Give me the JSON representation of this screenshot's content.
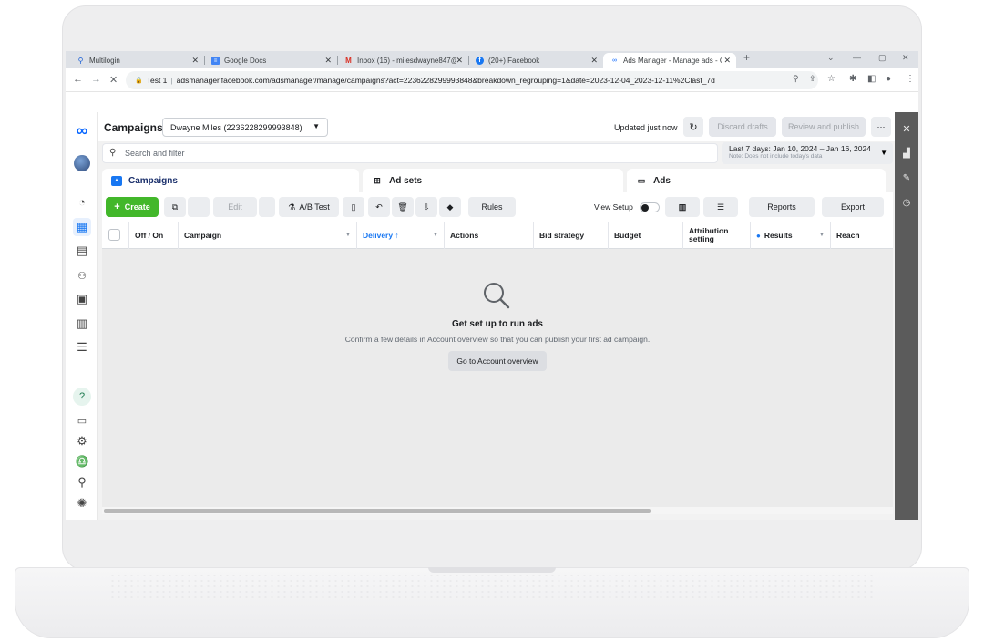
{
  "browser": {
    "tabs": [
      {
        "label": "Multilogin",
        "icon": "user-icon"
      },
      {
        "label": "Google Docs",
        "icon": "docs-icon"
      },
      {
        "label": "Inbox (16) - milesdwayne847@g",
        "icon": "gmail-icon"
      },
      {
        "label": "(20+) Facebook",
        "icon": "facebook-icon"
      },
      {
        "label": "Ads Manager - Manage ads - Ca",
        "icon": "meta-icon"
      }
    ],
    "profile_label": "Test 1",
    "url": "adsmanager.facebook.com/adsmanager/manage/campaigns?act=2236228299993848&breakdown_regrouping=1&date=2023-12-04_2023-12-11%2Clast_7d"
  },
  "header": {
    "title": "Campaigns",
    "account": "Dwayne Miles (2236228299993848)",
    "updated": "Updated just now",
    "discard_drafts": "Discard drafts",
    "review_publish": "Review and publish",
    "more": "···"
  },
  "search": {
    "placeholder": "Search and filter",
    "date_range": "Last 7 days: Jan 10, 2024 – Jan 16, 2024",
    "date_note": "Note: Does not include today's data"
  },
  "level_tabs": [
    {
      "label": "Campaigns"
    },
    {
      "label": "Ad sets"
    },
    {
      "label": "Ads"
    }
  ],
  "toolbar": {
    "create": "Create",
    "edit": "Edit",
    "ab_test": "A/B Test",
    "rules": "Rules",
    "view_setup": "View Setup",
    "reports": "Reports",
    "export": "Export"
  },
  "columns": [
    "Off / On",
    "Campaign",
    "Delivery ↑",
    "Actions",
    "Bid strategy",
    "Budget",
    "Attribution setting",
    "Results",
    "Reach"
  ],
  "empty_state": {
    "title": "Get set up to run ads",
    "message": "Confirm a few details in Account overview so that you can publish your first ad campaign.",
    "button": "Go to Account overview"
  },
  "colors": {
    "accent_blue": "#1877f2",
    "create_green": "#42b72a",
    "right_rail": "#5b5b5b"
  }
}
